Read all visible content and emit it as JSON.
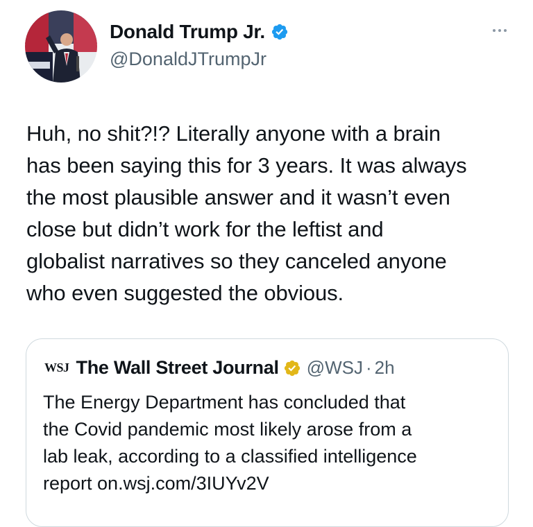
{
  "author": {
    "name": "Donald Trump Jr.",
    "handle": "@DonaldJTrumpJr",
    "verified_color": "#1d9bf0"
  },
  "tweet": {
    "lines": [
      "Huh, no shit?!? Literally anyone with a brain",
      "has been saying this for 3 years. It was always",
      "the most plausible answer and it wasn’t even",
      "close but didn’t work for the leftist and",
      "globalist narratives so they canceled anyone",
      "who even suggested the obvious."
    ]
  },
  "quoted": {
    "logo_text": "WSJ",
    "name": "The Wall Street Journal",
    "handle": "@WSJ",
    "separator": "·",
    "time": "2h",
    "badge_color": "#e2b719",
    "lines": [
      "The Energy Department has concluded that",
      "the Covid pandemic most likely arose from a",
      "lab leak, according to a classified intelligence",
      "report  on.wsj.com/3IUYv2V"
    ]
  },
  "icons": {
    "more": "more-horizontal-icon",
    "verified": "verified-badge-icon"
  }
}
